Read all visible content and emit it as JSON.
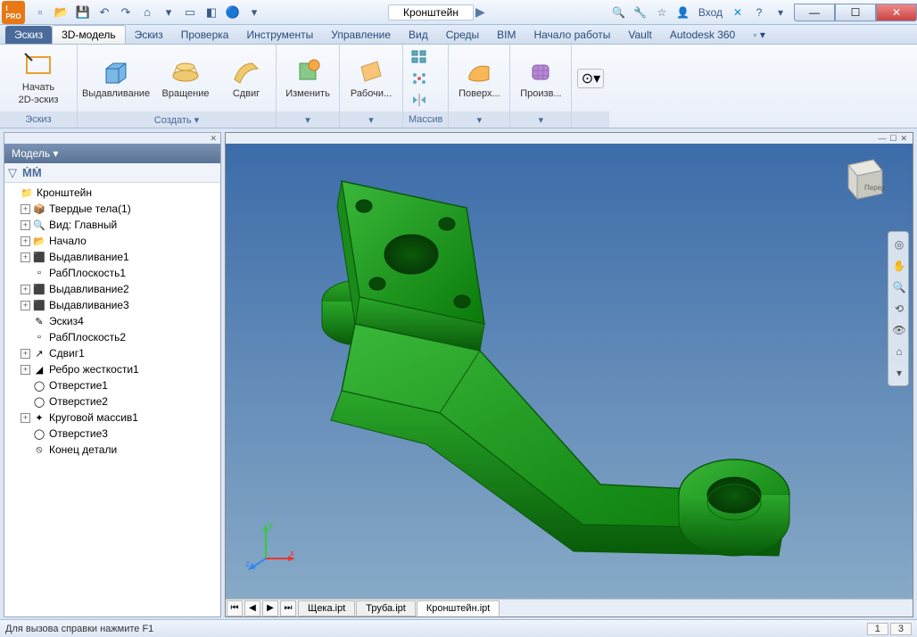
{
  "app": {
    "doc_title": "Кронштейн",
    "login": "Вход"
  },
  "tabs": {
    "sketch": "Эскиз",
    "model3d": "3D-модель",
    "sketch2": "Эскиз",
    "check": "Проверка",
    "tools": "Инструменты",
    "manage": "Управление",
    "view": "Вид",
    "env": "Среды",
    "bim": "BIM",
    "start": "Начало работы",
    "vault": "Vault",
    "a360": "Autodesk 360"
  },
  "ribbon": {
    "sketch_group": "Эскиз",
    "start_sketch": "Начать\n2D-эскиз",
    "create_group": "Создать ▾",
    "extrude": "Выдавливание",
    "revolve": "Вращение",
    "sweep": "Сдвиг",
    "modify_group": "",
    "modify": "Изменить",
    "workfeat": "Рабочи...",
    "pattern_group": "Массив",
    "surface": "Поверх...",
    "freeform": "Произв..."
  },
  "browser": {
    "title": "Модель ▾",
    "items": [
      {
        "icon": "📁",
        "label": "Кронштейн",
        "indent": 0,
        "expand": ""
      },
      {
        "icon": "📦",
        "label": "Твердые тела(1)",
        "indent": 1,
        "expand": "+"
      },
      {
        "icon": "🔍",
        "label": "Вид: Главный",
        "indent": 1,
        "expand": "+"
      },
      {
        "icon": "📂",
        "label": "Начало",
        "indent": 1,
        "expand": "+"
      },
      {
        "icon": "⬛",
        "label": "Выдавливание1",
        "indent": 1,
        "expand": "+"
      },
      {
        "icon": "▫",
        "label": "РабПлоскость1",
        "indent": 1,
        "expand": ""
      },
      {
        "icon": "⬛",
        "label": "Выдавливание2",
        "indent": 1,
        "expand": "+"
      },
      {
        "icon": "⬛",
        "label": "Выдавливание3",
        "indent": 1,
        "expand": "+"
      },
      {
        "icon": "✎",
        "label": "Эскиз4",
        "indent": 1,
        "expand": ""
      },
      {
        "icon": "▫",
        "label": "РабПлоскость2",
        "indent": 1,
        "expand": ""
      },
      {
        "icon": "↗",
        "label": "Сдвиг1",
        "indent": 1,
        "expand": "+"
      },
      {
        "icon": "◢",
        "label": "Ребро жесткости1",
        "indent": 1,
        "expand": "+"
      },
      {
        "icon": "◯",
        "label": "Отверстие1",
        "indent": 1,
        "expand": ""
      },
      {
        "icon": "◯",
        "label": "Отверстие2",
        "indent": 1,
        "expand": ""
      },
      {
        "icon": "✦",
        "label": "Круговой массив1",
        "indent": 1,
        "expand": "+"
      },
      {
        "icon": "◯",
        "label": "Отверстие3",
        "indent": 1,
        "expand": ""
      },
      {
        "icon": "⦸",
        "label": "Конец детали",
        "indent": 1,
        "expand": ""
      }
    ]
  },
  "viewcube": {
    "face": "Перед"
  },
  "doctabs": {
    "t1": "Щека.ipt",
    "t2": "Труба.ipt",
    "t3": "Кронштейн.ipt"
  },
  "status": {
    "help": "Для вызова справки нажмите F1",
    "n1": "1",
    "n2": "3"
  },
  "axis": {
    "x": "x",
    "y": "y",
    "z": "z"
  }
}
